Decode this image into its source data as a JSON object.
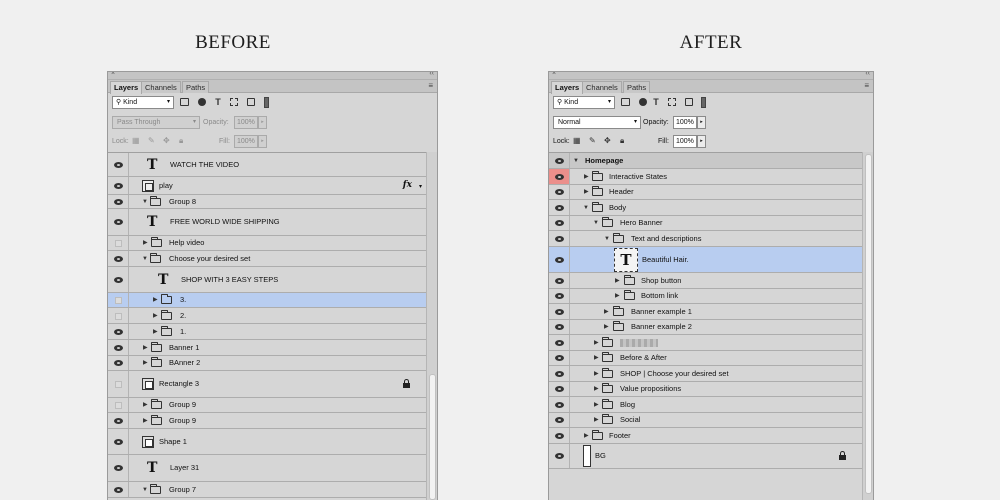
{
  "before": {
    "heading": "BEFORE",
    "tabs": [
      "Layers",
      "Channels",
      "Paths"
    ],
    "filter": {
      "kind": "Kind"
    },
    "blend_mode": "Pass Through",
    "opacity_label": "Opacity:",
    "opacity": "100%",
    "lock_label": "Lock:",
    "fill_label": "Fill:",
    "fill": "100%",
    "layers": [
      {
        "name": "WATCH THE VIDEO"
      },
      {
        "name": "play",
        "fx": "fx"
      },
      {
        "name": "Group 8"
      },
      {
        "name": "FREE WORLD WIDE SHIPPING"
      },
      {
        "name": "Help video"
      },
      {
        "name": "Choose your desired set"
      },
      {
        "name": "SHOP WITH 3 EASY STEPS"
      },
      {
        "name": "3."
      },
      {
        "name": "2."
      },
      {
        "name": "1."
      },
      {
        "name": "Banner 1"
      },
      {
        "name": "BAnner 2"
      },
      {
        "name": "Rectangle 3"
      },
      {
        "name": "Group 9"
      },
      {
        "name": "Group 9"
      },
      {
        "name": "Shape 1"
      },
      {
        "name": "Layer 31"
      },
      {
        "name": "Group 7"
      }
    ]
  },
  "after": {
    "heading": "AFTER",
    "tabs": [
      "Layers",
      "Channels",
      "Paths"
    ],
    "filter": {
      "kind": "Kind"
    },
    "blend_mode": "Normal",
    "opacity_label": "Opacity:",
    "opacity": "100%",
    "lock_label": "Lock:",
    "fill_label": "Fill:",
    "fill": "100%",
    "layers": [
      {
        "name": "Homepage"
      },
      {
        "name": "Interactive States"
      },
      {
        "name": "Header"
      },
      {
        "name": "Body"
      },
      {
        "name": "Hero Banner"
      },
      {
        "name": "Text and descriptions"
      },
      {
        "name": "Beautiful Hair."
      },
      {
        "name": "Shop button"
      },
      {
        "name": "Bottom link"
      },
      {
        "name": "Banner example 1"
      },
      {
        "name": "Banner example 2"
      },
      {
        "name": ""
      },
      {
        "name": "Before & After"
      },
      {
        "name": "SHOP | Choose your desired set"
      },
      {
        "name": "Value propositions"
      },
      {
        "name": "Blog"
      },
      {
        "name": "Social"
      },
      {
        "name": "Footer"
      },
      {
        "name": "BG"
      }
    ]
  },
  "colors": {
    "selected_row": "#b8cdf0",
    "highlight_eye": "#eb8f8b",
    "panel_bg": "#d6d6d6"
  },
  "icons": [
    "eye-icon",
    "folder-icon",
    "text-layer-icon",
    "smart-object-icon",
    "shape-icon",
    "lock-icon",
    "fx-icon"
  ]
}
